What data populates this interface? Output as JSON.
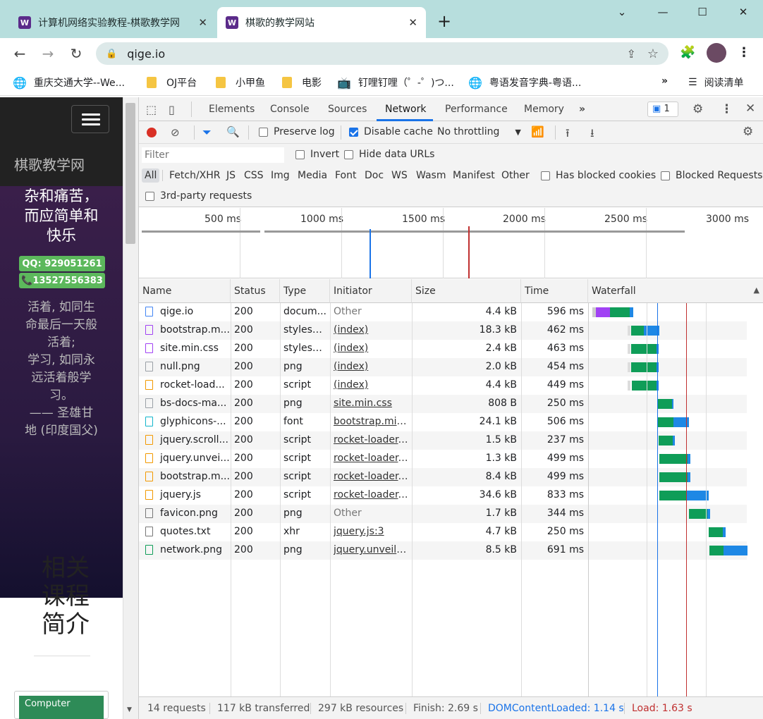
{
  "tabs": [
    {
      "title": "计算机网络实验教程-棋歌教学网",
      "favicon": "W"
    },
    {
      "title": "棋歌的教学网站",
      "favicon": "W"
    }
  ],
  "address": "qige.io",
  "bookmarks": [
    "重庆交通大学--We...",
    "OJ平台",
    "小甲鱼",
    "电影",
    "钉哩钉哩（゜-゜)つ...",
    "粤语发音字典-粤语...",
    "阅读清单"
  ],
  "page": {
    "brand": "棋歌教学网",
    "hero_lines": [
      "杂和痛苦，",
      "而应简单和",
      "快乐"
    ],
    "qq": "QQ: 929051261",
    "phone": "📞13527556383",
    "quote_lines": [
      "活着, 如同生",
      "命最后一天般",
      "活着;",
      "学习, 如同永",
      "远活着般学",
      "习。",
      "—— 圣雄甘",
      "地 (印度国父)"
    ],
    "related_lines": [
      "相关",
      "课程",
      "简介"
    ],
    "card_label": "Computer"
  },
  "devtools": {
    "tabs": [
      "Elements",
      "Console",
      "Sources",
      "Network",
      "Performance",
      "Memory"
    ],
    "active_tab": "Network",
    "issues_count": "1",
    "preserve_log": "Preserve log",
    "disable_cache": "Disable cache",
    "throttling": "No throttling",
    "filter_placeholder": "Filter",
    "invert": "Invert",
    "hide_data_urls": "Hide data URLs",
    "types": [
      "All",
      "Fetch/XHR",
      "JS",
      "CSS",
      "Img",
      "Media",
      "Font",
      "Doc",
      "WS",
      "Wasm",
      "Manifest",
      "Other"
    ],
    "has_blocked_cookies": "Has blocked cookies",
    "blocked_requests": "Blocked Requests",
    "third_party": "3rd-party requests",
    "timeline_ticks": [
      "500 ms",
      "1000 ms",
      "1500 ms",
      "2000 ms",
      "2500 ms",
      "3000 ms"
    ],
    "columns": [
      "Name",
      "Status",
      "Type",
      "Initiator",
      "Size",
      "Time",
      "Waterfall"
    ],
    "rows": [
      {
        "name": "qige.io",
        "status": "200",
        "type": "docum...",
        "initiator": "Other",
        "size": "4.4 kB",
        "time": "596 ms",
        "icon": "doc"
      },
      {
        "name": "bootstrap.m...",
        "status": "200",
        "type": "stylesh...",
        "initiator": "(index)",
        "size": "18.3 kB",
        "time": "462 ms",
        "icon": "css"
      },
      {
        "name": "site.min.css",
        "status": "200",
        "type": "stylesh...",
        "initiator": "(index)",
        "size": "2.4 kB",
        "time": "463 ms",
        "icon": "css"
      },
      {
        "name": "null.png",
        "status": "200",
        "type": "png",
        "initiator": "(index)",
        "size": "2.0 kB",
        "time": "454 ms",
        "icon": "img"
      },
      {
        "name": "rocket-load...",
        "status": "200",
        "type": "script",
        "initiator": "(index)",
        "size": "4.4 kB",
        "time": "449 ms",
        "icon": "js"
      },
      {
        "name": "bs-docs-ma...",
        "status": "200",
        "type": "png",
        "initiator": "site.min.css",
        "size": "808 B",
        "time": "250 ms",
        "icon": "img"
      },
      {
        "name": "glyphicons-...",
        "status": "200",
        "type": "font",
        "initiator": "bootstrap.min...",
        "size": "24.1 kB",
        "time": "506 ms",
        "icon": "font"
      },
      {
        "name": "jquery.scroll...",
        "status": "200",
        "type": "script",
        "initiator": "rocket-loader....",
        "size": "1.5 kB",
        "time": "237 ms",
        "icon": "js"
      },
      {
        "name": "jquery.unvei...",
        "status": "200",
        "type": "script",
        "initiator": "rocket-loader....",
        "size": "1.3 kB",
        "time": "499 ms",
        "icon": "js"
      },
      {
        "name": "bootstrap.m...",
        "status": "200",
        "type": "script",
        "initiator": "rocket-loader....",
        "size": "8.4 kB",
        "time": "499 ms",
        "icon": "js"
      },
      {
        "name": "jquery.js",
        "status": "200",
        "type": "script",
        "initiator": "rocket-loader....",
        "size": "34.6 kB",
        "time": "833 ms",
        "icon": "js"
      },
      {
        "name": "favicon.png",
        "status": "200",
        "type": "png",
        "initiator": "Other",
        "size": "1.7 kB",
        "time": "344 ms",
        "icon": "other"
      },
      {
        "name": "quotes.txt",
        "status": "200",
        "type": "xhr",
        "initiator": "jquery.js:3",
        "size": "4.7 kB",
        "time": "250 ms",
        "icon": "other"
      },
      {
        "name": "network.png",
        "status": "200",
        "type": "png",
        "initiator": "jquery.unveil....",
        "size": "8.5 kB",
        "time": "691 ms",
        "icon": "png"
      }
    ],
    "status": {
      "requests": "14 requests",
      "transferred": "117 kB transferred",
      "resources": "297 kB resources",
      "finish": "Finish: 2.69 s",
      "dcl": "DOMContentLoaded: 1.14 s",
      "load": "Load: 1.63 s"
    }
  },
  "colors": {
    "tabstrip": "#b7dedd",
    "accent": "#1a73e8",
    "load": "#c03030",
    "dcl": "#1a73e8",
    "ttfb": "#0f9d58",
    "download": "#1e88e5"
  }
}
